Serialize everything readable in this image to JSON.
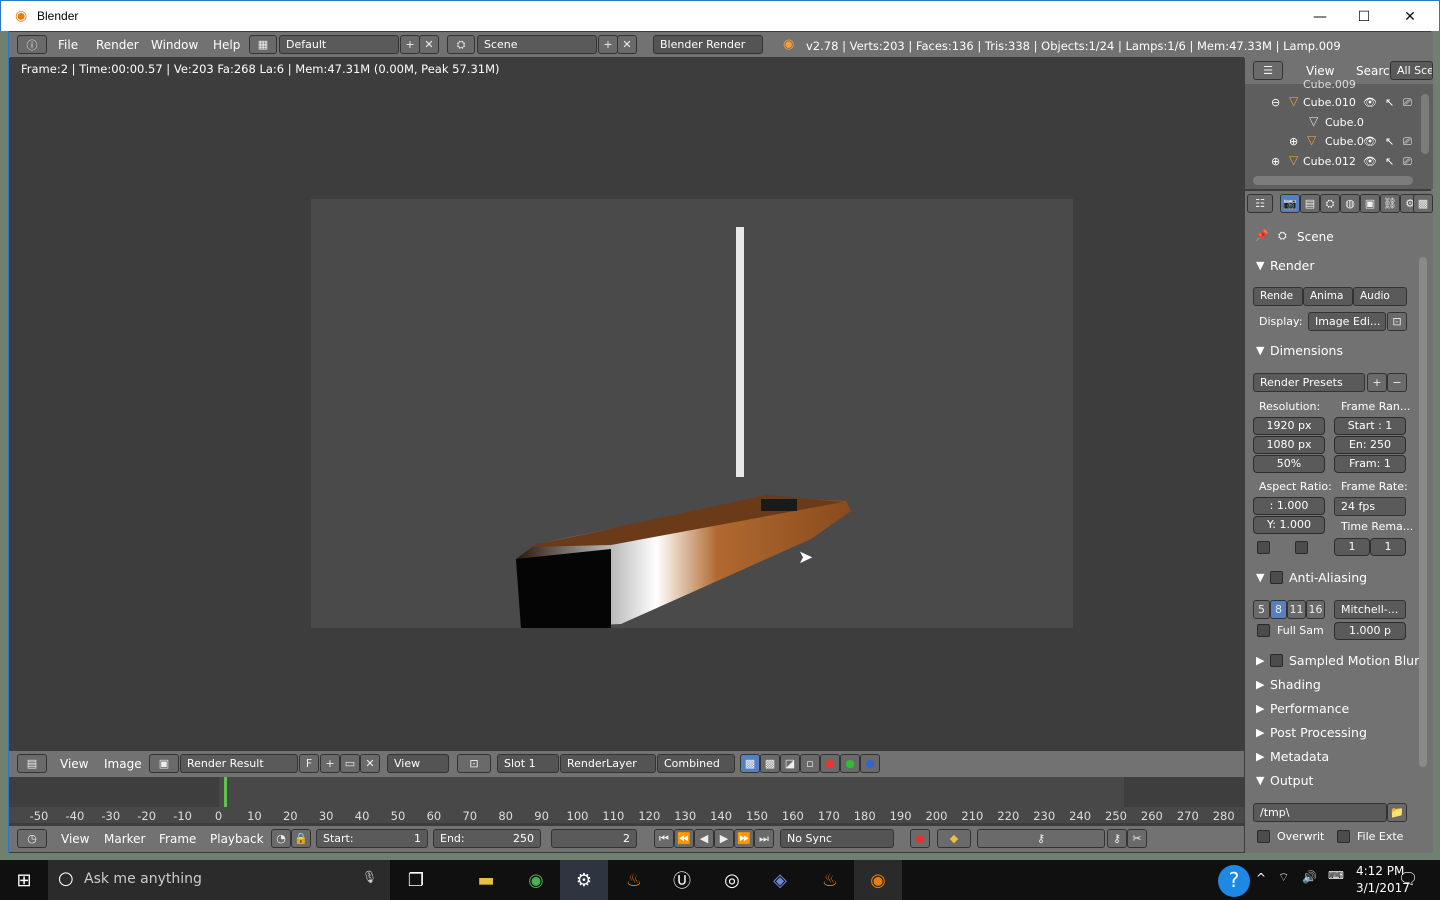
{
  "window": {
    "title": "Blender",
    "minimize": "—",
    "maximize": "☐",
    "close": "✕"
  },
  "info_header": {
    "menus": [
      "File",
      "Render",
      "Window",
      "Help"
    ],
    "layout": "Default",
    "scene": "Scene",
    "engine": "Blender Render",
    "stats": "v2.78 | Verts:203 | Faces:136 | Tris:338 | Objects:1/24 | Lamps:1/6 | Mem:47.33M | Lamp.009"
  },
  "image_editor": {
    "render_info": "Frame:2 | Time:00:00.57 | Ve:203 Fa:268 La:6 | Mem:47.31M (0.00M, Peak 57.31M)",
    "menus": [
      "View",
      "Image"
    ],
    "image_name": "Render Result",
    "fake_user": "F",
    "view_mode": "View",
    "slot": "Slot 1",
    "layer": "RenderLayer",
    "pass": "Combined"
  },
  "outliner": {
    "menus": [
      "View",
      "Search"
    ],
    "filter": "All Sce",
    "items": [
      "Cube.009",
      "Cube.010",
      "Cube.0",
      "Cube.0",
      "Cube.012"
    ]
  },
  "properties": {
    "context": "Scene",
    "render": {
      "title": "Render",
      "buttons": [
        "Rende",
        "Anima",
        "Audio"
      ],
      "display_label": "Display:",
      "display_value": "Image Edi..."
    },
    "dimensions": {
      "title": "Dimensions",
      "presets": "Render Presets",
      "resolution_label": "Resolution:",
      "res_x": "1920 px",
      "res_y": "1080 px",
      "res_pct": "50%",
      "frame_range_label": "Frame Ran...",
      "start": "Start : 1",
      "end": "En:  250",
      "step": "Fram:  1",
      "aspect_label": "Aspect Ratio:",
      "aspect_x": ":  1.000",
      "aspect_y": "Y: 1.000",
      "frame_rate_label": "Frame Rate:",
      "fps": "24 fps",
      "time_remap_label": "Time Rema...",
      "remap_old": "1",
      "remap_new": "1"
    },
    "anti_aliasing": {
      "title": "Anti-Aliasing",
      "samples": [
        "5",
        "8",
        "11",
        "16"
      ],
      "selected_sample": "8",
      "filter": "Mitchell-...",
      "full_sample": "Full Sam",
      "size": "1.000 p"
    },
    "panels": [
      "Sampled Motion Blur",
      "Shading",
      "Performance",
      "Post Processing",
      "Metadata"
    ],
    "output": {
      "title": "Output",
      "path": "/tmp\\",
      "overwrite": "Overwrit",
      "file_ext": "File Exte"
    }
  },
  "timeline": {
    "ticks": [
      "-50",
      "-40",
      "-30",
      "-20",
      "-10",
      "0",
      "10",
      "20",
      "30",
      "40",
      "50",
      "60",
      "70",
      "80",
      "90",
      "100",
      "110",
      "120",
      "130",
      "140",
      "150",
      "160",
      "170",
      "180",
      "190",
      "200",
      "210",
      "220",
      "230",
      "240",
      "250",
      "260",
      "270",
      "280"
    ],
    "menus": [
      "View",
      "Marker",
      "Frame",
      "Playback"
    ],
    "start": "Start:",
    "start_value": "1",
    "end": "End:",
    "end_value": "250",
    "current_frame": "2",
    "sync": "No Sync"
  },
  "taskbar": {
    "search_placeholder": "Ask me anything",
    "time": "4:12 PM",
    "date": "3/1/2017",
    "help": "?"
  },
  "colors": {
    "accent_blue": "#5680c2",
    "window_border": "#2b79c6",
    "boat_wood": "#8a4a1c"
  }
}
